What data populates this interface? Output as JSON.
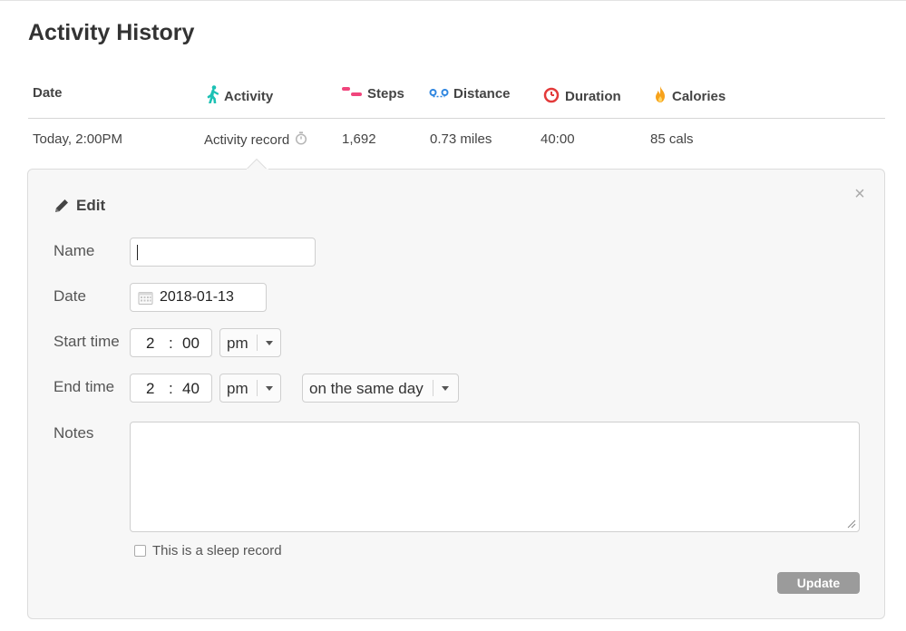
{
  "page": {
    "title": "Activity History"
  },
  "table": {
    "headers": {
      "date": "Date",
      "activity": "Activity",
      "steps": "Steps",
      "distance": "Distance",
      "duration": "Duration",
      "calories": "Calories"
    },
    "header_icons": {
      "activity": "walking-person-icon",
      "steps": "footsteps-icon",
      "distance": "distance-icon",
      "duration": "stopwatch-icon",
      "calories": "flame-icon"
    },
    "colors": {
      "activity_icon": "#1cc1b4",
      "steps_icon": "#f0457c",
      "distance_icon": "#2f86e0",
      "duration_icon": "#e33a3a",
      "calories_icon": "#f7a21b"
    },
    "rows": [
      {
        "date": "Today, 2:00PM",
        "activity": "Activity record",
        "steps": "1,692",
        "distance": "0.73 miles",
        "duration": "40:00",
        "calories": "85 cals"
      }
    ]
  },
  "edit": {
    "heading": "Edit",
    "name_label": "Name",
    "name_value": "",
    "date_label": "Date",
    "date_value": "2018-01-13",
    "start_label": "Start time",
    "start_hour": "2",
    "start_minute": "00",
    "start_ampm": "pm",
    "end_label": "End time",
    "end_hour": "2",
    "end_minute": "40",
    "end_ampm": "pm",
    "end_day": "on the same day",
    "time_separator": ":",
    "notes_label": "Notes",
    "notes_value": "",
    "sleep_label": "This is a sleep record",
    "sleep_checked": false,
    "update_label": "Update",
    "close_symbol": "×"
  }
}
